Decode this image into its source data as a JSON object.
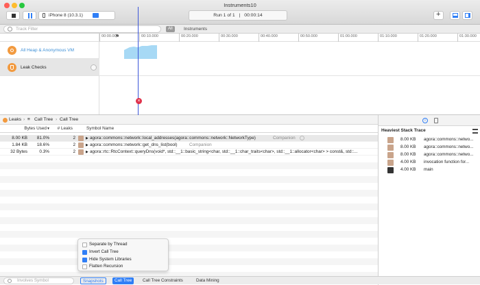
{
  "window": {
    "title": "Instruments10"
  },
  "toolbar": {
    "device": "iPhone 8 (10.3.1)",
    "run_status": "Run 1 of 1",
    "separator": "|",
    "elapsed": "00:00:14"
  },
  "filter_bar": {
    "placeholder": "Track Filter",
    "all_badge": "All",
    "instruments_label": "Instruments"
  },
  "timeline": {
    "ticks": [
      "00:00.000",
      "00:10.000",
      "00:20.000",
      "00:30.000",
      "00:40.000",
      "00:50.000",
      "01:00.000",
      "01:10.000",
      "01:20.000",
      "01:30.000"
    ],
    "tracks": [
      {
        "label": "All Heap & Anonymous VM"
      },
      {
        "label": "Leak Checks"
      }
    ]
  },
  "detail": {
    "breadcrumb": [
      "Leaks",
      "Call Tree",
      "Call Tree"
    ],
    "columns": {
      "bytes_used": "Bytes Used",
      "leaks": "# Leaks",
      "symbol": "Symbol Name"
    },
    "rows": [
      {
        "bytes": "8.00 KB",
        "pct": "81.0%",
        "leaks": "2",
        "symbol": "agora::commons::network::local_addresses(agora::commons::network::NetworkType)",
        "library": "Companion"
      },
      {
        "bytes": "1.84 KB",
        "pct": "18.6%",
        "leaks": "2",
        "symbol": "agora::commons::network::get_dns_list(bool)",
        "library": "Companion"
      },
      {
        "bytes": "32 Bytes",
        "pct": "0.3%",
        "leaks": "2",
        "symbol": "agora::rtc::RtcContext::queryDns(void*, std::__1::basic_string<char, std::__1::char_traits<char>, std::__1::allocator<char> > const&, std::...",
        "library": ""
      }
    ]
  },
  "inspector": {
    "title": "Heaviest Stack Trace",
    "frames": [
      {
        "size": "8.00 KB",
        "name": "agora::commons::netwo..."
      },
      {
        "size": "8.00 KB",
        "name": "agora::commons::netwo..."
      },
      {
        "size": "8.00 KB",
        "name": "agora::commons::netwo..."
      },
      {
        "size": "4.00 KB",
        "name": "invocation function for..."
      },
      {
        "size": "4.00 KB",
        "name": "main"
      }
    ]
  },
  "popover": {
    "options": [
      {
        "label": "Separate by Thread",
        "checked": false
      },
      {
        "label": "Invert Call Tree",
        "checked": true
      },
      {
        "label": "Hide System Libraries",
        "checked": true
      },
      {
        "label": "Flatten Recursion",
        "checked": false
      }
    ]
  },
  "bottom_bar": {
    "involves_symbol_placeholder": "Involves Symbol",
    "tabs": [
      "Snapshots",
      "Call Tree",
      "Call Tree Constraints",
      "Data Mining"
    ]
  },
  "colors": {
    "accent": "#2f7ef6",
    "heap_track": "#a7d9f5",
    "leak_marker": "#e0334c",
    "playhead": "#3b55d9"
  }
}
